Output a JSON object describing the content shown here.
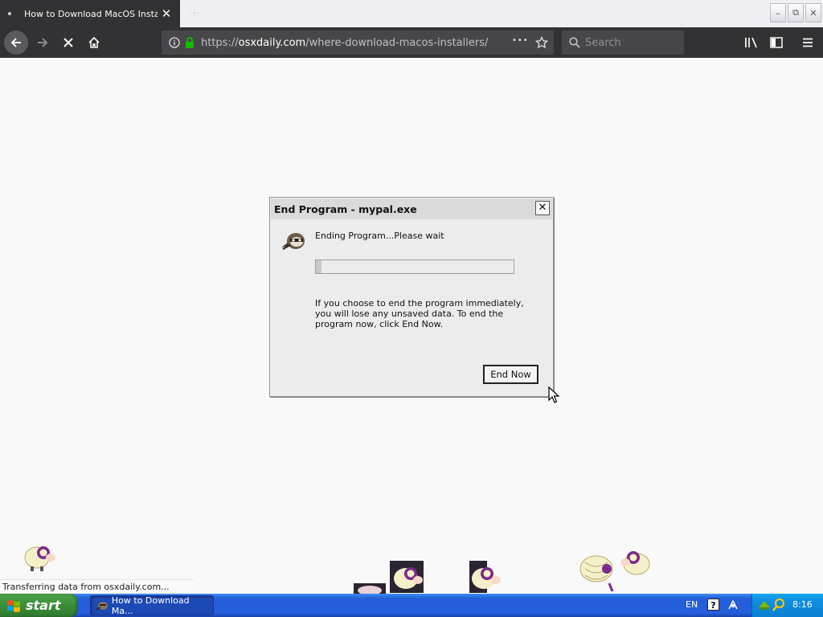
{
  "browser": {
    "tab_title": "How to Download MacOS Installers",
    "tab_close_glyph": "✕",
    "new_tab_glyph": "+",
    "url_scheme": "https://",
    "url_host": "osxdaily.com",
    "url_path": "/where-download-macos-installers/",
    "url_more_glyph": "•••",
    "search_placeholder": "Search",
    "status_text": "Transferring data from osxdaily.com..."
  },
  "window_buttons": {
    "minimize": "–",
    "restore": "⧉",
    "close": "✕"
  },
  "dialog": {
    "title": "End Program - mypal.exe",
    "close_glyph": "✕",
    "message": "Ending Program...Please wait",
    "progress_fraction": 0.03,
    "body": "If you choose to end the program immediately, you will lose any unsaved data. To end the program now, click End Now.",
    "end_now_label": "End Now"
  },
  "taskbar": {
    "start_label": "start",
    "task_item": "How to Download Ma...",
    "language": "EN",
    "help_glyph": "?",
    "clock": "8:16"
  },
  "colors": {
    "tab_active": "#323234",
    "nav_bg": "#323234",
    "url_bg": "#474749",
    "secure_lock": "#12bc00",
    "taskbar_blue": "#245edb",
    "start_green": "#3b8e38",
    "sheep_wool": "#f5f0c8",
    "sheep_horn": "#7a2a8a"
  },
  "icons": [
    "back-arrow-icon",
    "forward-arrow-icon",
    "stop-icon",
    "home-icon",
    "info-icon",
    "lock-icon",
    "star-icon",
    "search-icon",
    "library-icon",
    "sidebar-icon",
    "menu-icon",
    "raccoon-app-icon",
    "mouse-pointer-icon",
    "windows-flag-icon",
    "sheep-icon"
  ]
}
